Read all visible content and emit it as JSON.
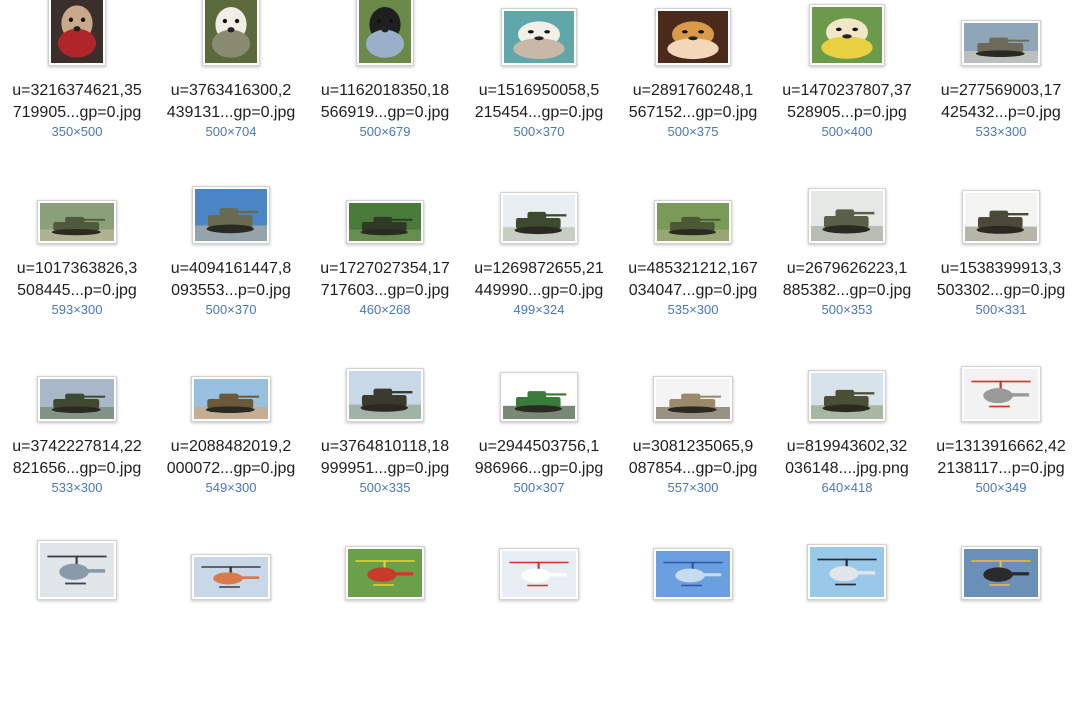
{
  "files": [
    {
      "name_line1": "u=3216374621,35",
      "name_line2": "719905...gp=0.jpg",
      "dims": "350×500",
      "icon": "pug-icon",
      "colors": [
        "#3a2f2a",
        "#c9a98a",
        "#b0252a"
      ]
    },
    {
      "name_line1": "u=3763416300,2",
      "name_line2": "439131...gp=0.jpg",
      "dims": "500×704",
      "icon": "white-dog-icon",
      "colors": [
        "#5a6a3a",
        "#f0ede6",
        "#8a8a70"
      ]
    },
    {
      "name_line1": "u=1162018350,18",
      "name_line2": "566919...gp=0.jpg",
      "dims": "500×679",
      "icon": "black-dog-icon",
      "colors": [
        "#6b8a4a",
        "#1f1f1f",
        "#9ab0c8"
      ]
    },
    {
      "name_line1": "u=1516950058,5",
      "name_line2": "215454...gp=0.jpg",
      "dims": "500×370",
      "icon": "bulldog-icon",
      "colors": [
        "#5fa7a8",
        "#f2efe8",
        "#c9b8a8"
      ]
    },
    {
      "name_line1": "u=2891760248,1",
      "name_line2": "567152...gp=0.jpg",
      "dims": "500×375",
      "icon": "puppy-kitten-icon",
      "colors": [
        "#4a2a1a",
        "#d99a4a",
        "#f2d8b8"
      ]
    },
    {
      "name_line1": "u=1470237807,37",
      "name_line2": "528905...p=0.jpg",
      "dims": "500×400",
      "icon": "puppy-icon",
      "colors": [
        "#6a9a4a",
        "#f2e6c8",
        "#e8d040"
      ]
    },
    {
      "name_line1": "u=277569003,17",
      "name_line2": "425432...p=0.jpg",
      "dims": "533×300",
      "icon": "tank-icon",
      "colors": [
        "#8fa5b8",
        "#6e6a5a",
        "#d8d0c0"
      ]
    },
    {
      "name_line1": "u=1017363826,3",
      "name_line2": "508445...p=0.jpg",
      "dims": "593×300",
      "icon": "tank-icon",
      "colors": [
        "#8aa07a",
        "#4e5a3a",
        "#c8c0a0"
      ]
    },
    {
      "name_line1": "u=4094161447,8",
      "name_line2": "093553...p=0.jpg",
      "dims": "500×370",
      "icon": "tank-icon",
      "colors": [
        "#4a86c6",
        "#6a6a50",
        "#c8b898"
      ]
    },
    {
      "name_line1": "u=1727027354,17",
      "name_line2": "717603...gp=0.jpg",
      "dims": "460×268",
      "icon": "tank-icon",
      "colors": [
        "#4a7a3a",
        "#2e3a26",
        "#7a9a5a"
      ]
    },
    {
      "name_line1": "u=1269872655,21",
      "name_line2": "449990...gp=0.jpg",
      "dims": "499×324",
      "icon": "tank-icon",
      "colors": [
        "#e8eef2",
        "#3e4a30",
        "#b0b8a0"
      ]
    },
    {
      "name_line1": "u=485321212,167",
      "name_line2": "034047...gp=0.jpg",
      "dims": "535×300",
      "icon": "tank-icon",
      "colors": [
        "#7a9a5a",
        "#4a5a36",
        "#a8b080"
      ]
    },
    {
      "name_line1": "u=2679626223,1",
      "name_line2": "885382...gp=0.jpg",
      "dims": "500×353",
      "icon": "tank-icon",
      "colors": [
        "#e6e8e6",
        "#5a6048",
        "#9aa090"
      ]
    },
    {
      "name_line1": "u=1538399913,3",
      "name_line2": "503302...gp=0.jpg",
      "dims": "500×331",
      "icon": "tank-icon",
      "colors": [
        "#f4f4f2",
        "#4a4a3a",
        "#8a8a7a"
      ]
    },
    {
      "name_line1": "u=3742227814,22",
      "name_line2": "821656...gp=0.jpg",
      "dims": "533×300",
      "icon": "tank-icon",
      "colors": [
        "#a8b8c8",
        "#3e4a30",
        "#6a7a5a"
      ]
    },
    {
      "name_line1": "u=2088482019,2",
      "name_line2": "000072...gp=0.jpg",
      "dims": "549×300",
      "icon": "tank-icon",
      "colors": [
        "#9ac0e0",
        "#6a5a3a",
        "#e0a060"
      ]
    },
    {
      "name_line1": "u=3764810118,18",
      "name_line2": "999951...gp=0.jpg",
      "dims": "500×335",
      "icon": "tank-icon",
      "colors": [
        "#c8d8e6",
        "#3a3a2e",
        "#8a9a80"
      ]
    },
    {
      "name_line1": "u=2944503756,1",
      "name_line2": "986966...gp=0.jpg",
      "dims": "500×307",
      "icon": "tank-icon",
      "colors": [
        "#ffffff",
        "#3a7a3a",
        "#1e3a1e"
      ]
    },
    {
      "name_line1": "u=3081235065,9",
      "name_line2": "087854...gp=0.jpg",
      "dims": "557×300",
      "icon": "tank-icon",
      "colors": [
        "#f4f4f4",
        "#9a8a6a",
        "#5a4e3a"
      ]
    },
    {
      "name_line1": "u=819943602,32",
      "name_line2": "036148....jpg.png",
      "dims": "640×418",
      "icon": "tank-icon",
      "colors": [
        "#d8e2ea",
        "#4a5036",
        "#8a9a70"
      ]
    },
    {
      "name_line1": "u=1313916662,42",
      "name_line2": "2138117...p=0.jpg",
      "dims": "500×349",
      "icon": "helicopter-icon",
      "colors": [
        "#f2f2f2",
        "#c83a2a",
        "#9a9a9a"
      ]
    },
    {
      "name_line1": "",
      "name_line2": "",
      "dims": "",
      "icon": "helicopter-icon",
      "colors": [
        "#e0e6ea",
        "#3a4046",
        "#8a9aa8"
      ]
    },
    {
      "name_line1": "",
      "name_line2": "",
      "dims": "",
      "icon": "helicopter-icon",
      "colors": [
        "#c8d8e8",
        "#2a2a2a",
        "#d87a4a"
      ]
    },
    {
      "name_line1": "",
      "name_line2": "",
      "dims": "",
      "icon": "helicopter-icon",
      "colors": [
        "#6aa04a",
        "#e8d030",
        "#c83a2a"
      ]
    },
    {
      "name_line1": "",
      "name_line2": "",
      "dims": "",
      "icon": "helicopter-icon",
      "colors": [
        "#e8eef4",
        "#c83a2a",
        "#ffffff"
      ]
    },
    {
      "name_line1": "",
      "name_line2": "",
      "dims": "",
      "icon": "helicopter-icon",
      "colors": [
        "#6aa0e0",
        "#2a5aa8",
        "#c8dcf0"
      ]
    },
    {
      "name_line1": "",
      "name_line2": "",
      "dims": "",
      "icon": "helicopter-icon",
      "colors": [
        "#9ac8e8",
        "#2a2a2a",
        "#e0e6ea"
      ]
    },
    {
      "name_line1": "",
      "name_line2": "",
      "dims": "",
      "icon": "helicopter-icon",
      "colors": [
        "#6a90b8",
        "#e8c020",
        "#2a2a2a"
      ]
    }
  ]
}
